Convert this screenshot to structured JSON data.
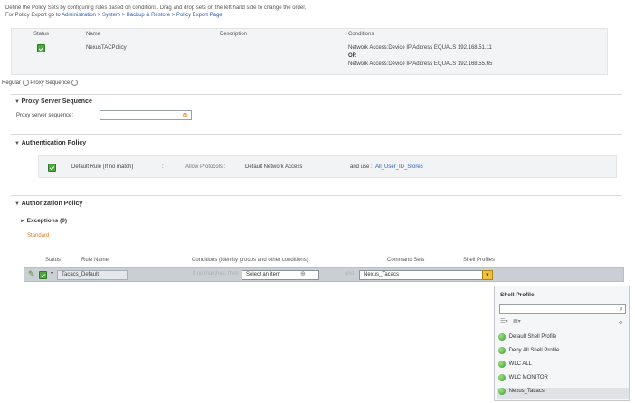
{
  "intro": {
    "line1": "Define the Policy Sets by configuring rules based on conditions. Drag and drop sets on the left hand side to change the order.",
    "line2_prefix": "For Policy Export go to",
    "line2_link": "Administration > System > Backup & Restore > Policy Export Page"
  },
  "policy_sets": {
    "headers": {
      "status": "Status",
      "name": "Name",
      "description": "Description",
      "conditions": "Conditions"
    },
    "row": {
      "name": "NexusTACPolicy",
      "cond1": "Network Access:Device IP Address EQUALS 192.168.51.11",
      "op": "OR",
      "cond2": "Network Access:Device IP Address EQUALS 192.168.55.65"
    }
  },
  "mode": {
    "regular": "Regular",
    "proxy": "Proxy Sequence"
  },
  "proxy": {
    "title": "Proxy Server Sequence",
    "label": "Proxy server sequence:"
  },
  "authentication": {
    "title": "Authentication Policy",
    "rule": "Default Rule (If no match)",
    "colon": ":",
    "allow": "Allow Protocols :",
    "protocols": "Default Network Access",
    "and_use": "and use :",
    "identity": "All_User_ID_Stores"
  },
  "authorization": {
    "title": "Authorization Policy",
    "exceptions": "Exceptions (0)",
    "standard": "Standard",
    "headers": {
      "status": "Status",
      "rule_name": "Rule Name",
      "conditions": "Conditions (identity groups and other conditions)",
      "command_sets": "Command Sets",
      "shell_profiles": "Shell Profiles"
    },
    "row": {
      "rule_name": "Tacacs_Default",
      "cond_placeholder": "if no matches, then",
      "select_item": "Select an item",
      "and_text": "and",
      "command_set": "Nexus_Tacacs"
    }
  },
  "shell_popup": {
    "title": "Shell Profile",
    "items": [
      "Default Shell Profile",
      "Deny All Shell Profile",
      "WLC ALL",
      "WLC MONITOR",
      "Nexus_Tacacs"
    ]
  },
  "colors": {
    "check": "#4caa3c",
    "link": "#2a5db0",
    "standard": "#e07a1f",
    "row_bar": "#c9cfd5"
  }
}
